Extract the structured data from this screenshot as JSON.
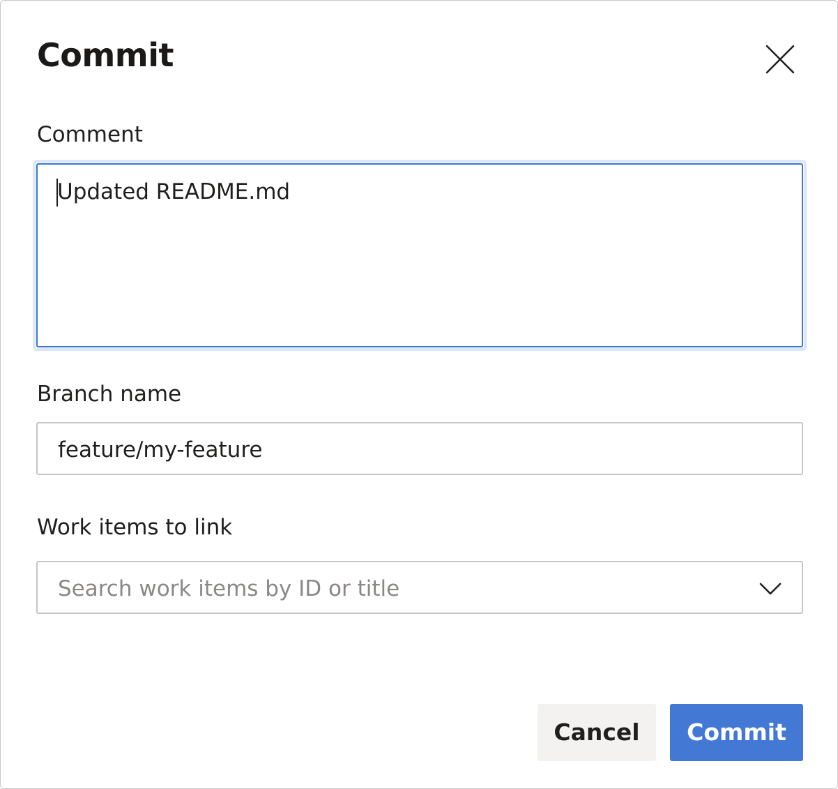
{
  "dialog": {
    "title": "Commit",
    "close_icon": "close-icon"
  },
  "comment": {
    "label": "Comment",
    "value": "Updated README.md"
  },
  "branch": {
    "label": "Branch name",
    "value": "feature/my-feature"
  },
  "work_items": {
    "label": "Work items to link",
    "placeholder": "Search work items by ID or title",
    "dropdown_icon": "chevron-down-icon"
  },
  "actions": {
    "cancel_label": "Cancel",
    "commit_label": "Commit"
  },
  "colors": {
    "accent": "#4379d4",
    "focus_border": "#3a76d1",
    "focus_halo": "#dbe6f7",
    "secondary_button": "#f3f2f1",
    "input_border": "#c8c6c4",
    "placeholder": "#8a8886"
  }
}
